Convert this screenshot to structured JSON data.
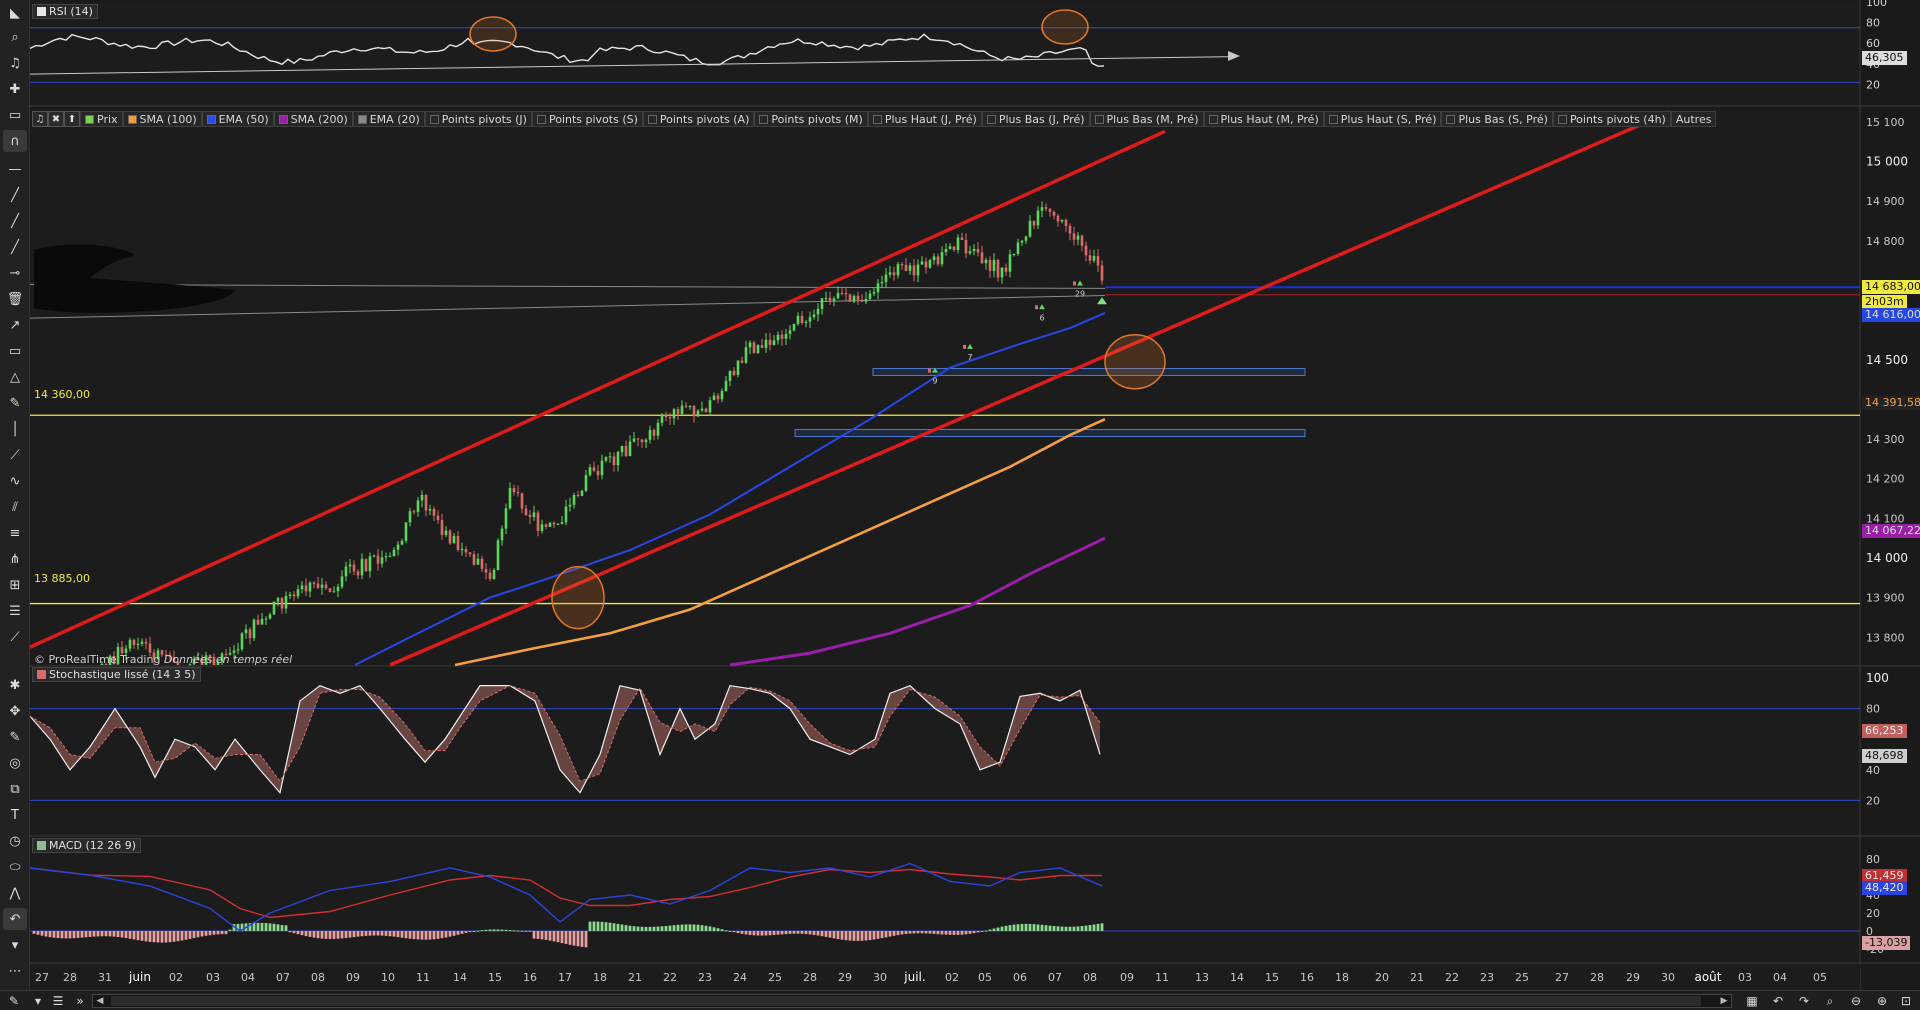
{
  "panels": {
    "rsi": {
      "label": "RSI (14)",
      "axis": [
        "100",
        "80",
        "60",
        "40",
        "20"
      ],
      "value_tag": "46,305"
    },
    "price": {
      "axis": [
        "15 100",
        "15 000",
        "14 900",
        "14 800",
        "14 700",
        "14 600",
        "14 500",
        "14 400",
        "14 300",
        "14 200",
        "14 100",
        "14 000",
        "13 900",
        "13 800"
      ],
      "tags": {
        "current": "14 683,00",
        "countdown": "2h03m",
        "ema50": "14 616,00",
        "sma100": "14 391,58",
        "sma200": "14 067,22"
      },
      "levels": {
        "upper": "14 360,00",
        "lower": "13 885,00"
      },
      "watermark_brand": "© ProRealTime Trading",
      "watermark_note": "Données en temps réel"
    },
    "stoch": {
      "label": "Stochastique lissé (14 3 5)",
      "axis": [
        "100",
        "80",
        "60",
        "40",
        "20"
      ],
      "tags": [
        "66,253",
        "48,698"
      ]
    },
    "macd": {
      "label": "MACD (12 26 9)",
      "axis": [
        "80",
        "60",
        "40",
        "20",
        "0",
        "-20"
      ],
      "tags": [
        "61,459",
        "48,420",
        "-13,039"
      ]
    }
  },
  "indicator_bar": [
    "Prix",
    "SMA (100)",
    "EMA (50)",
    "SMA (200)",
    "EMA (20)",
    "Points pivots (J)",
    "Points pivots (S)",
    "Points pivots (A)",
    "Points pivots (M)",
    "Plus Haut (J, Pré)",
    "Plus Bas (J, Pré)",
    "Plus Bas (M, Pré)",
    "Plus Haut (M, Pré)",
    "Plus Haut (S, Pré)",
    "Plus Bas (S, Pré)",
    "Points pivots (4h)",
    "Autres"
  ],
  "indicator_colors": [
    "#7fcf5a",
    "#f39a3c",
    "#2a4de0",
    "#9a1ea8",
    "#888888"
  ],
  "signal_labels": [
    "9",
    "7",
    "6",
    "29"
  ],
  "x_axis": [
    "27",
    "28",
    "31",
    "juin",
    "02",
    "03",
    "04",
    "07",
    "08",
    "09",
    "10",
    "11",
    "14",
    "15",
    "16",
    "17",
    "18",
    "21",
    "22",
    "23",
    "24",
    "25",
    "28",
    "29",
    "30",
    "juil.",
    "02",
    "05",
    "06",
    "07",
    "08",
    "09",
    "11",
    "13",
    "14",
    "15",
    "16",
    "18",
    "20",
    "21",
    "22",
    "23",
    "25",
    "27",
    "28",
    "29",
    "30",
    "août",
    "03",
    "04",
    "05"
  ],
  "colors": {
    "bg": "#1a1a1a",
    "up": "#5cd65c",
    "down": "#d96a6a",
    "channel": "#e01b1b",
    "ema50": "#2747e6",
    "sma100": "#f4a040",
    "sma200": "#9b1ea8",
    "level": "#f2ea3a",
    "rsi": "#e6e6e6"
  }
}
